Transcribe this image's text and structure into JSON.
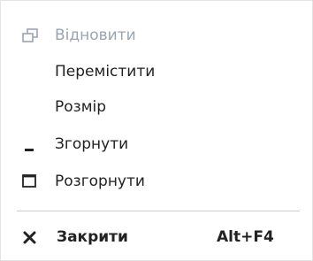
{
  "menu": {
    "items": [
      {
        "label": "Відновити",
        "icon": "restore-icon",
        "state": "disabled"
      },
      {
        "label": "Перемістити",
        "icon": ""
      },
      {
        "label": "Розмір",
        "icon": ""
      },
      {
        "label": "Згорнути",
        "icon": "minimize-icon"
      },
      {
        "label": "Розгорнути",
        "icon": "maximize-icon"
      }
    ],
    "close": {
      "label": "Закрити",
      "shortcut": "Alt+F4",
      "icon": "close-icon"
    }
  },
  "colors": {
    "disabled_text": "#9aa4b5",
    "text": "#222222",
    "background": "#ffffff",
    "separator": "#cfcfcf"
  }
}
